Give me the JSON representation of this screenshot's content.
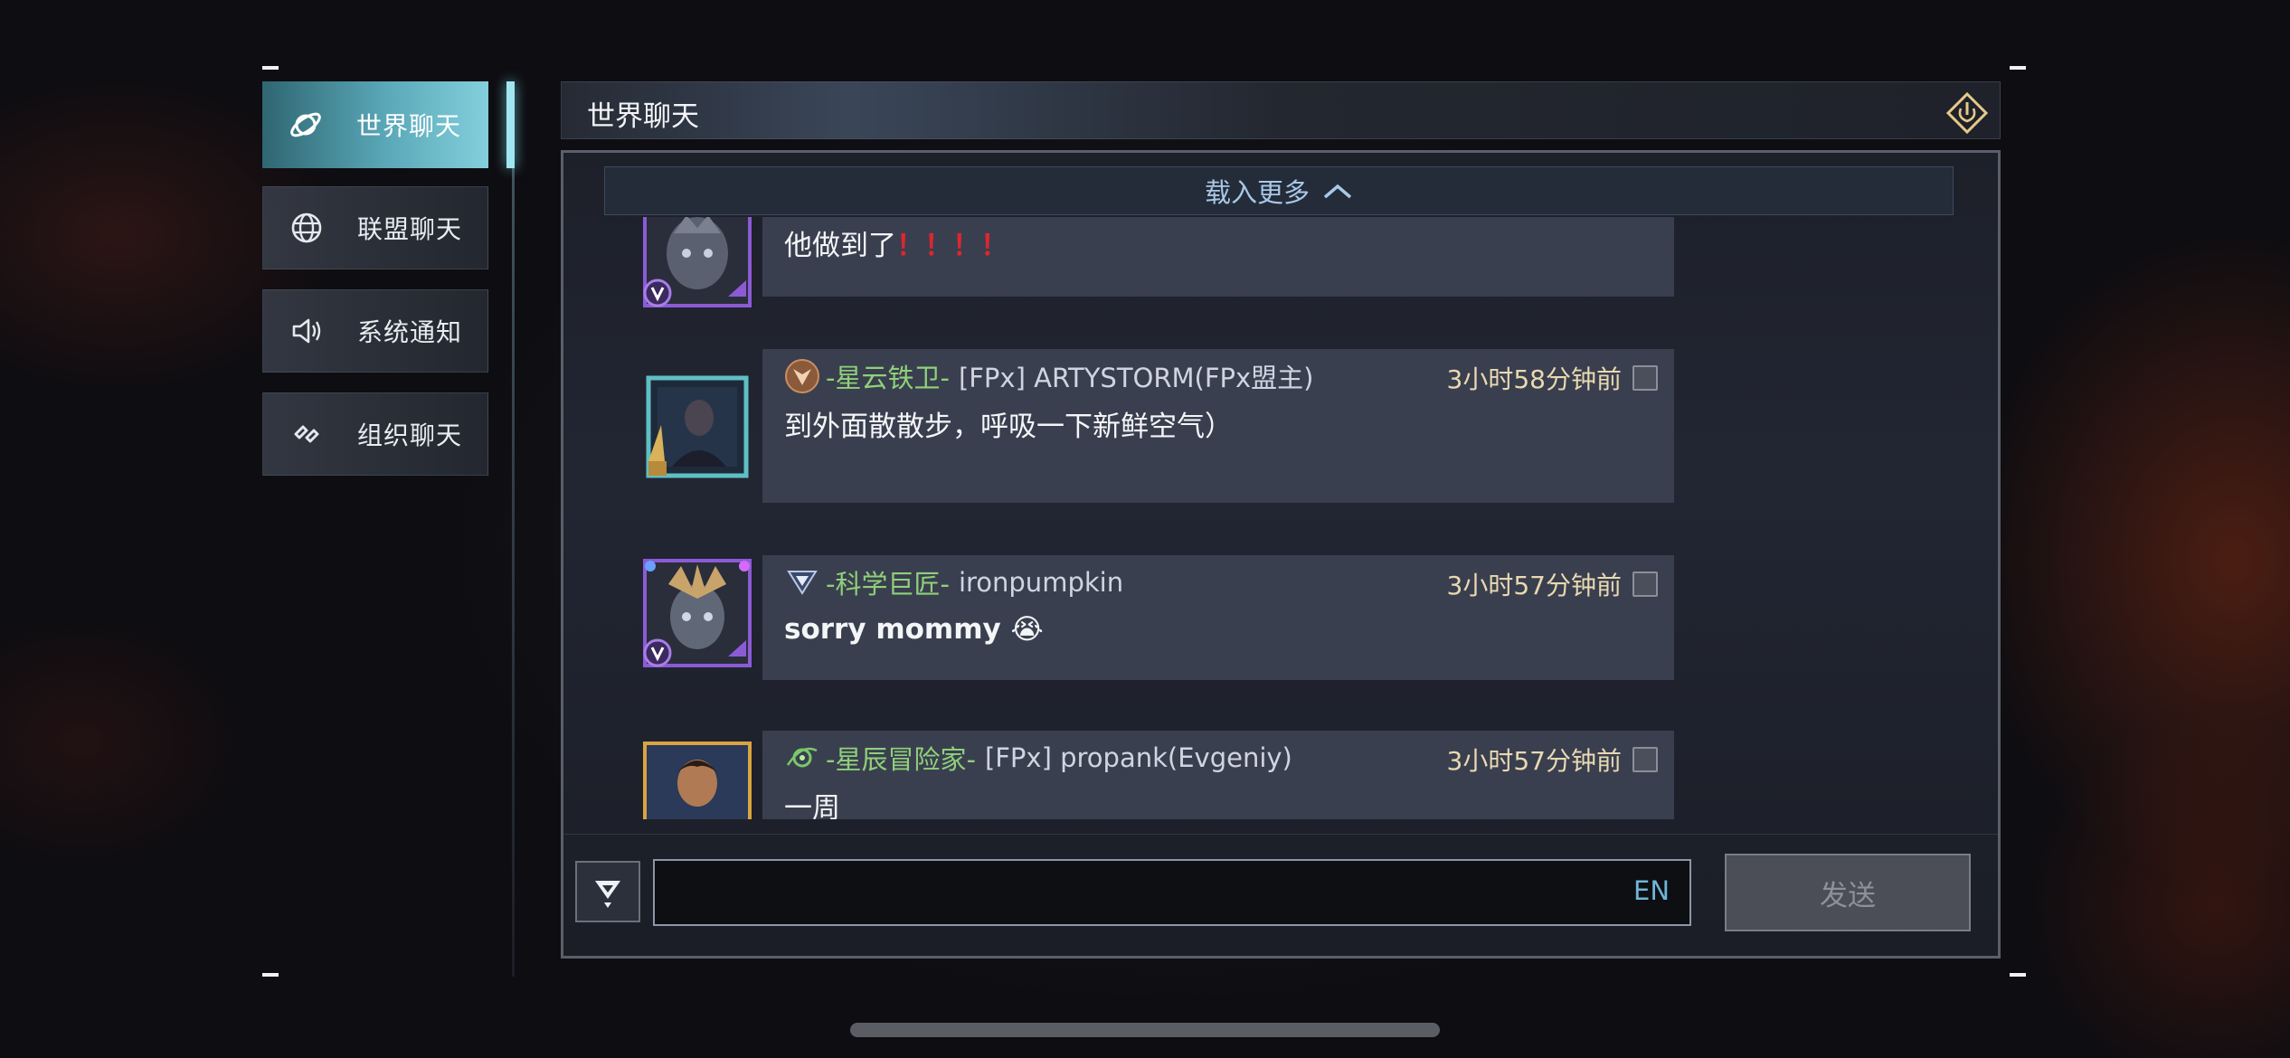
{
  "sidebar": {
    "tabs": [
      {
        "label": "世界聊天",
        "icon": "planet-icon"
      },
      {
        "label": "联盟聊天",
        "icon": "globe-icon"
      },
      {
        "label": "系统通知",
        "icon": "speaker-icon"
      },
      {
        "label": "组织聊天",
        "icon": "link-icon"
      }
    ]
  },
  "header": {
    "title": "世界聊天",
    "exit_icon": "power-exit-icon"
  },
  "chat": {
    "load_more": "载入更多",
    "messages": [
      {
        "text": "他做到了",
        "exclamations": "！！！！",
        "avatar_frame": "#8b5bd6"
      },
      {
        "title": "-星云铁卫-",
        "name": "[FPx] ARTYSTORM(FPx盟主)",
        "time": "3小时58分钟前",
        "text": "到外面散散步，呼吸一下新鲜空气）",
        "avatar_frame": "#5fbfc4"
      },
      {
        "title": "-科学巨匠-",
        "name": "ironpumpkin",
        "time": "3小时57分钟前",
        "text": "sorry mommy 😭",
        "avatar_frame": "#8b5bd6"
      },
      {
        "title": "-星辰冒险家-",
        "name": "[FPx] propank(Evgeniy)",
        "time": "3小时57分钟前",
        "text": "一周",
        "avatar_frame": "#d9a441"
      }
    ]
  },
  "input": {
    "value": "",
    "lang": "EN",
    "send_label": "发送"
  },
  "colors": {
    "active_tab": "#5aa8b8",
    "title_green": "#8fd07a",
    "time_gold": "#e8d9b0",
    "bubble": "#3a3f4f"
  }
}
